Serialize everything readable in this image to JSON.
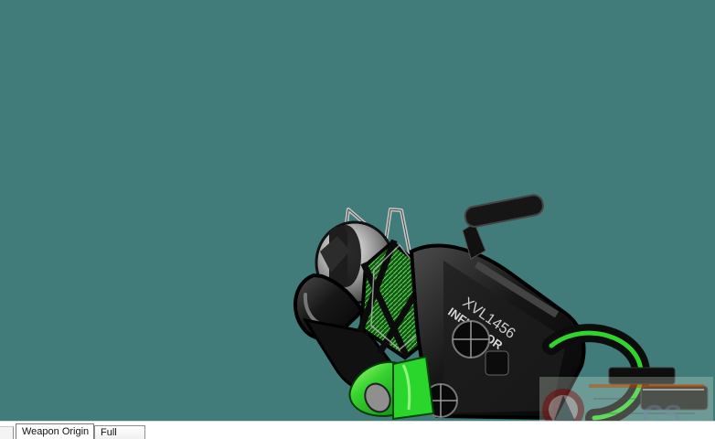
{
  "window": {
    "viewport_background": "#417c7b"
  },
  "model": {
    "subject": "weapon-model",
    "barrel_label": "XVL1456",
    "side_label": "INFLICTOR",
    "accent_color": "#2fd82f",
    "body_color": "#151515"
  },
  "tabs": [
    {
      "label": "Weapon Origin",
      "selected": true
    },
    {
      "label": "Full",
      "selected": false
    }
  ],
  "watermark": {
    "text": "CS"
  }
}
